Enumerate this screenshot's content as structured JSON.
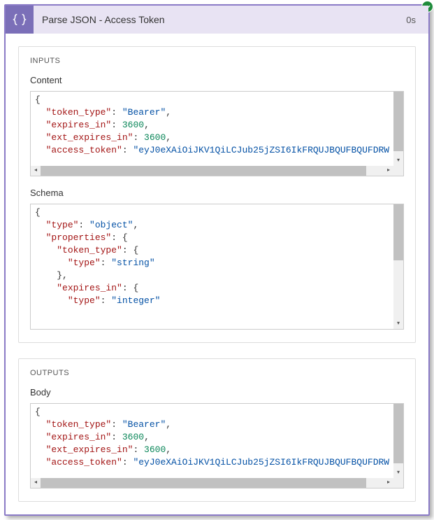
{
  "header": {
    "title": "Parse JSON - Access Token",
    "duration": "0s"
  },
  "inputs": {
    "section_label": "INPUTS",
    "content_label": "Content",
    "content_json": {
      "token_type_key": "\"token_type\"",
      "token_type_val": "\"Bearer\"",
      "expires_in_key": "\"expires_in\"",
      "expires_in_val": "3600",
      "ext_expires_in_key": "\"ext_expires_in\"",
      "ext_expires_in_val": "3600",
      "access_token_key": "\"access_token\"",
      "access_token_val": "\"eyJ0eXAiOiJKV1QiLCJub25jZSI6IkFRQUJBQUFBQUFDRW"
    },
    "schema_label": "Schema",
    "schema_json": {
      "type_key": "\"type\"",
      "type_val": "\"object\"",
      "properties_key": "\"properties\"",
      "token_type_key": "\"token_type\"",
      "inner_type_key": "\"type\"",
      "string_val": "\"string\"",
      "expires_in_key": "\"expires_in\"",
      "integer_val": "\"integer\""
    }
  },
  "outputs": {
    "section_label": "OUTPUTS",
    "body_label": "Body",
    "body_json": {
      "token_type_key": "\"token_type\"",
      "token_type_val": "\"Bearer\"",
      "expires_in_key": "\"expires_in\"",
      "expires_in_val": "3600",
      "ext_expires_in_key": "\"ext_expires_in\"",
      "ext_expires_in_val": "3600",
      "access_token_key": "\"access_token\"",
      "access_token_val": "\"eyJ0eXAiOiJKV1QiLCJub25jZSI6IkFRQUJBQUFBQUFDRW"
    }
  }
}
